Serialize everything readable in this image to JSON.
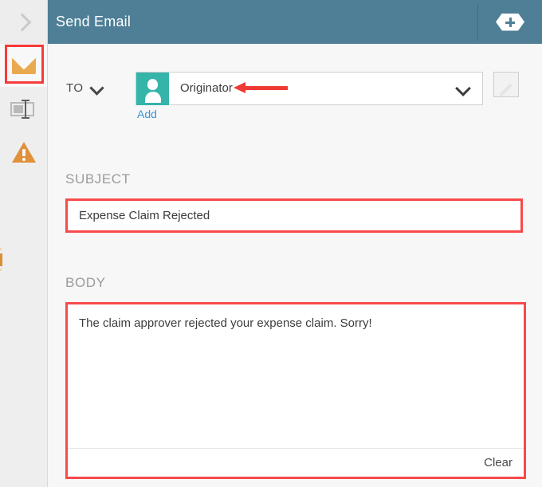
{
  "header": {
    "title": "Send Email",
    "add_button_icon": "plus-hexagon-icon",
    "accent_color": "#4e7f96"
  },
  "rail": {
    "toggle_icon": "chevron-right-icon",
    "items": [
      {
        "icon": "envelope-icon",
        "name": "email",
        "selected": true
      },
      {
        "icon": "input-field-icon",
        "name": "form-field",
        "selected": false
      },
      {
        "icon": "warning-triangle-icon",
        "name": "alert",
        "selected": false
      }
    ],
    "highlight_color": "#f93a3a"
  },
  "form": {
    "to": {
      "label": "TO",
      "dropdown_icon": "chevron-down-icon",
      "recipient": "Originator",
      "recipient_avatar_icon": "user-avatar-icon",
      "recipient_avatar_color": "#35b4aa",
      "recipient_dropdown_icon": "chevron-down-icon",
      "add_label": "Add",
      "add_link_color": "#3a93d8",
      "edit_icon": "pencil-icon",
      "edit_enabled": false
    },
    "subject": {
      "label": "SUBJECT",
      "value": "Expense Claim Rejected",
      "placeholder": ""
    },
    "body": {
      "label": "BODY",
      "value": "The claim approver rejected your expense claim. Sorry!",
      "placeholder": "",
      "clear_label": "Clear"
    }
  },
  "annotations": {
    "arrow_color": "#f03a34",
    "highlight_border_color": "#f84a4a",
    "arrow_points_to": "Originator"
  }
}
